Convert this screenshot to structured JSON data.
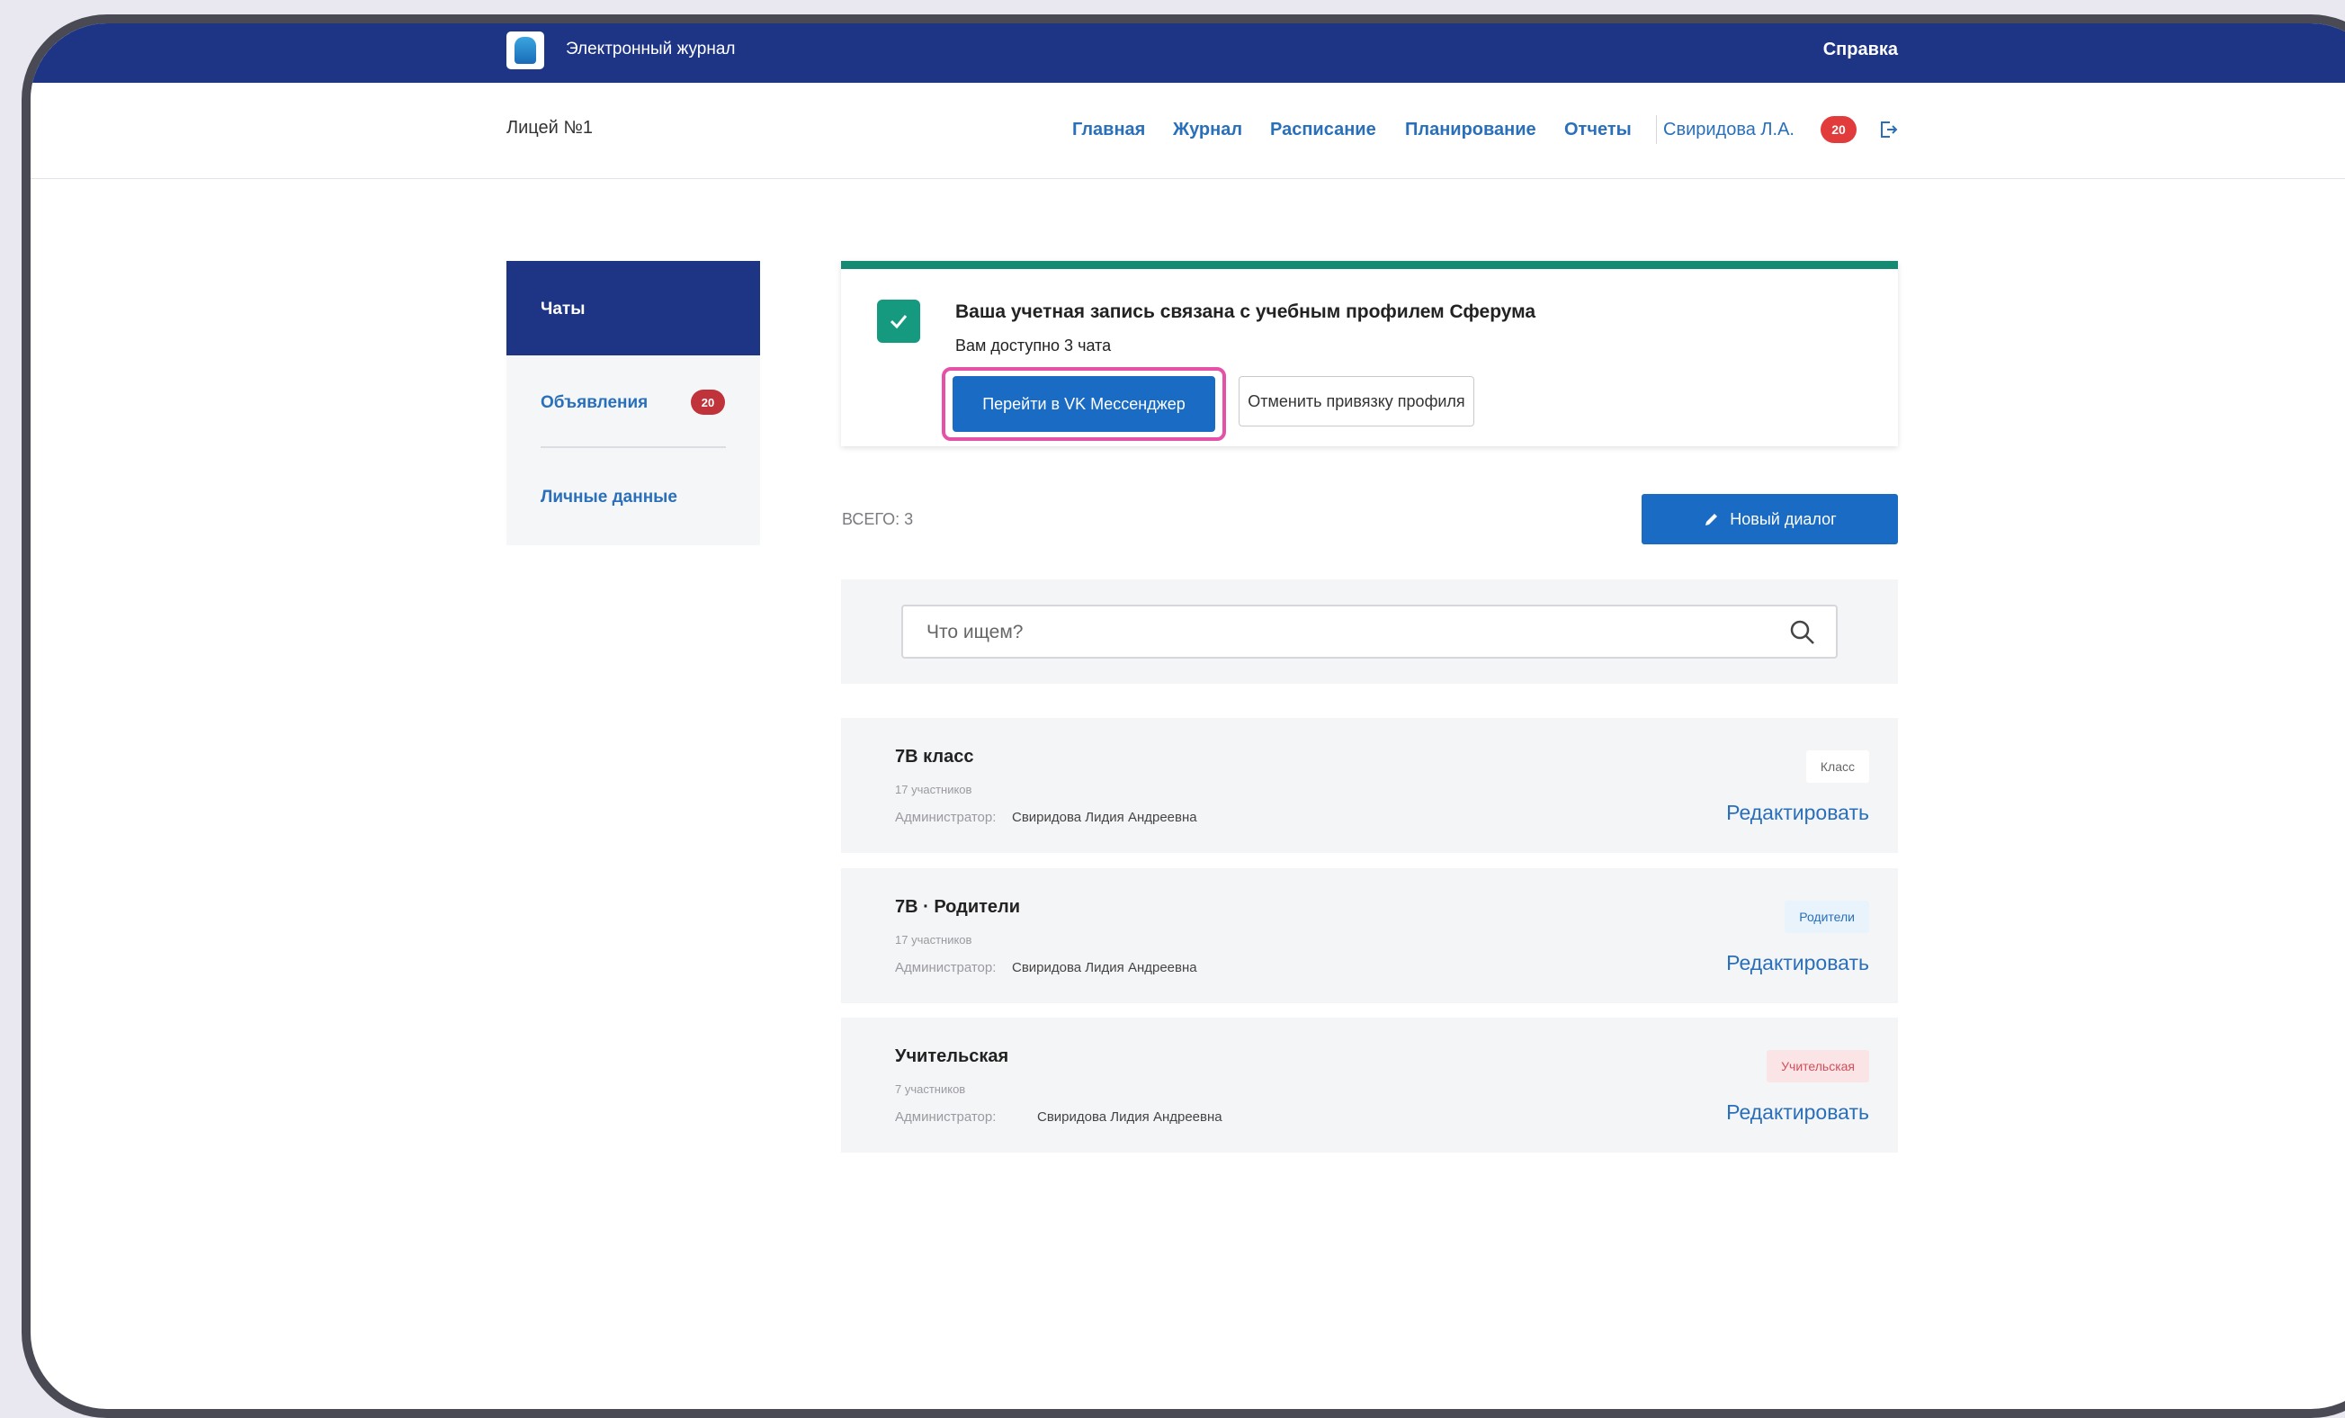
{
  "header": {
    "app_title": "Электронный журнал",
    "help": "Справка"
  },
  "navbar": {
    "school": "Лицей №1",
    "links": [
      "Главная",
      "Журнал",
      "Расписание",
      "Планирование",
      "Отчеты"
    ],
    "user": "Свиридова Л.А.",
    "notifications": "20"
  },
  "sidebar": {
    "items": [
      {
        "label": "Чаты"
      },
      {
        "label": "Объявления",
        "badge": "20"
      },
      {
        "label": "Личные данные"
      }
    ]
  },
  "banner": {
    "title": "Ваша учетная запись связана с учебным профилем Сферума",
    "subtitle": "Вам доступно 3 чата",
    "primary_button": "Перейти в VK Мессенджер",
    "secondary_button": "Отменить привязку профиля"
  },
  "list": {
    "total": "ВСЕГО: 3",
    "new_dialog": "Новый диалог",
    "search_placeholder": "Что ищем?"
  },
  "chats": [
    {
      "title": "7В класс",
      "members": "17 участников",
      "admin_label": "Администратор:",
      "admin": "Свиридова Лидия Андреевна",
      "tag": "Класс",
      "edit": "Редактировать"
    },
    {
      "title": "7В · Родители",
      "members": "17 участников",
      "admin_label": "Администратор:",
      "admin": "Свиридова Лидия Андреевна",
      "tag": "Родители",
      "edit": "Редактировать"
    },
    {
      "title": "Учительская",
      "members": "7 участников",
      "admin_label": "Администратор:",
      "admin": "Свиридова Лидия Андреевна",
      "tag": "Учительская",
      "edit": "Редактировать"
    }
  ],
  "colors": {
    "primary_dark": "#1e3586",
    "primary": "#1a6bc4",
    "link": "#2a6fba",
    "success": "#148a72",
    "highlight": "#e651a8",
    "danger": "#e23b3b"
  }
}
